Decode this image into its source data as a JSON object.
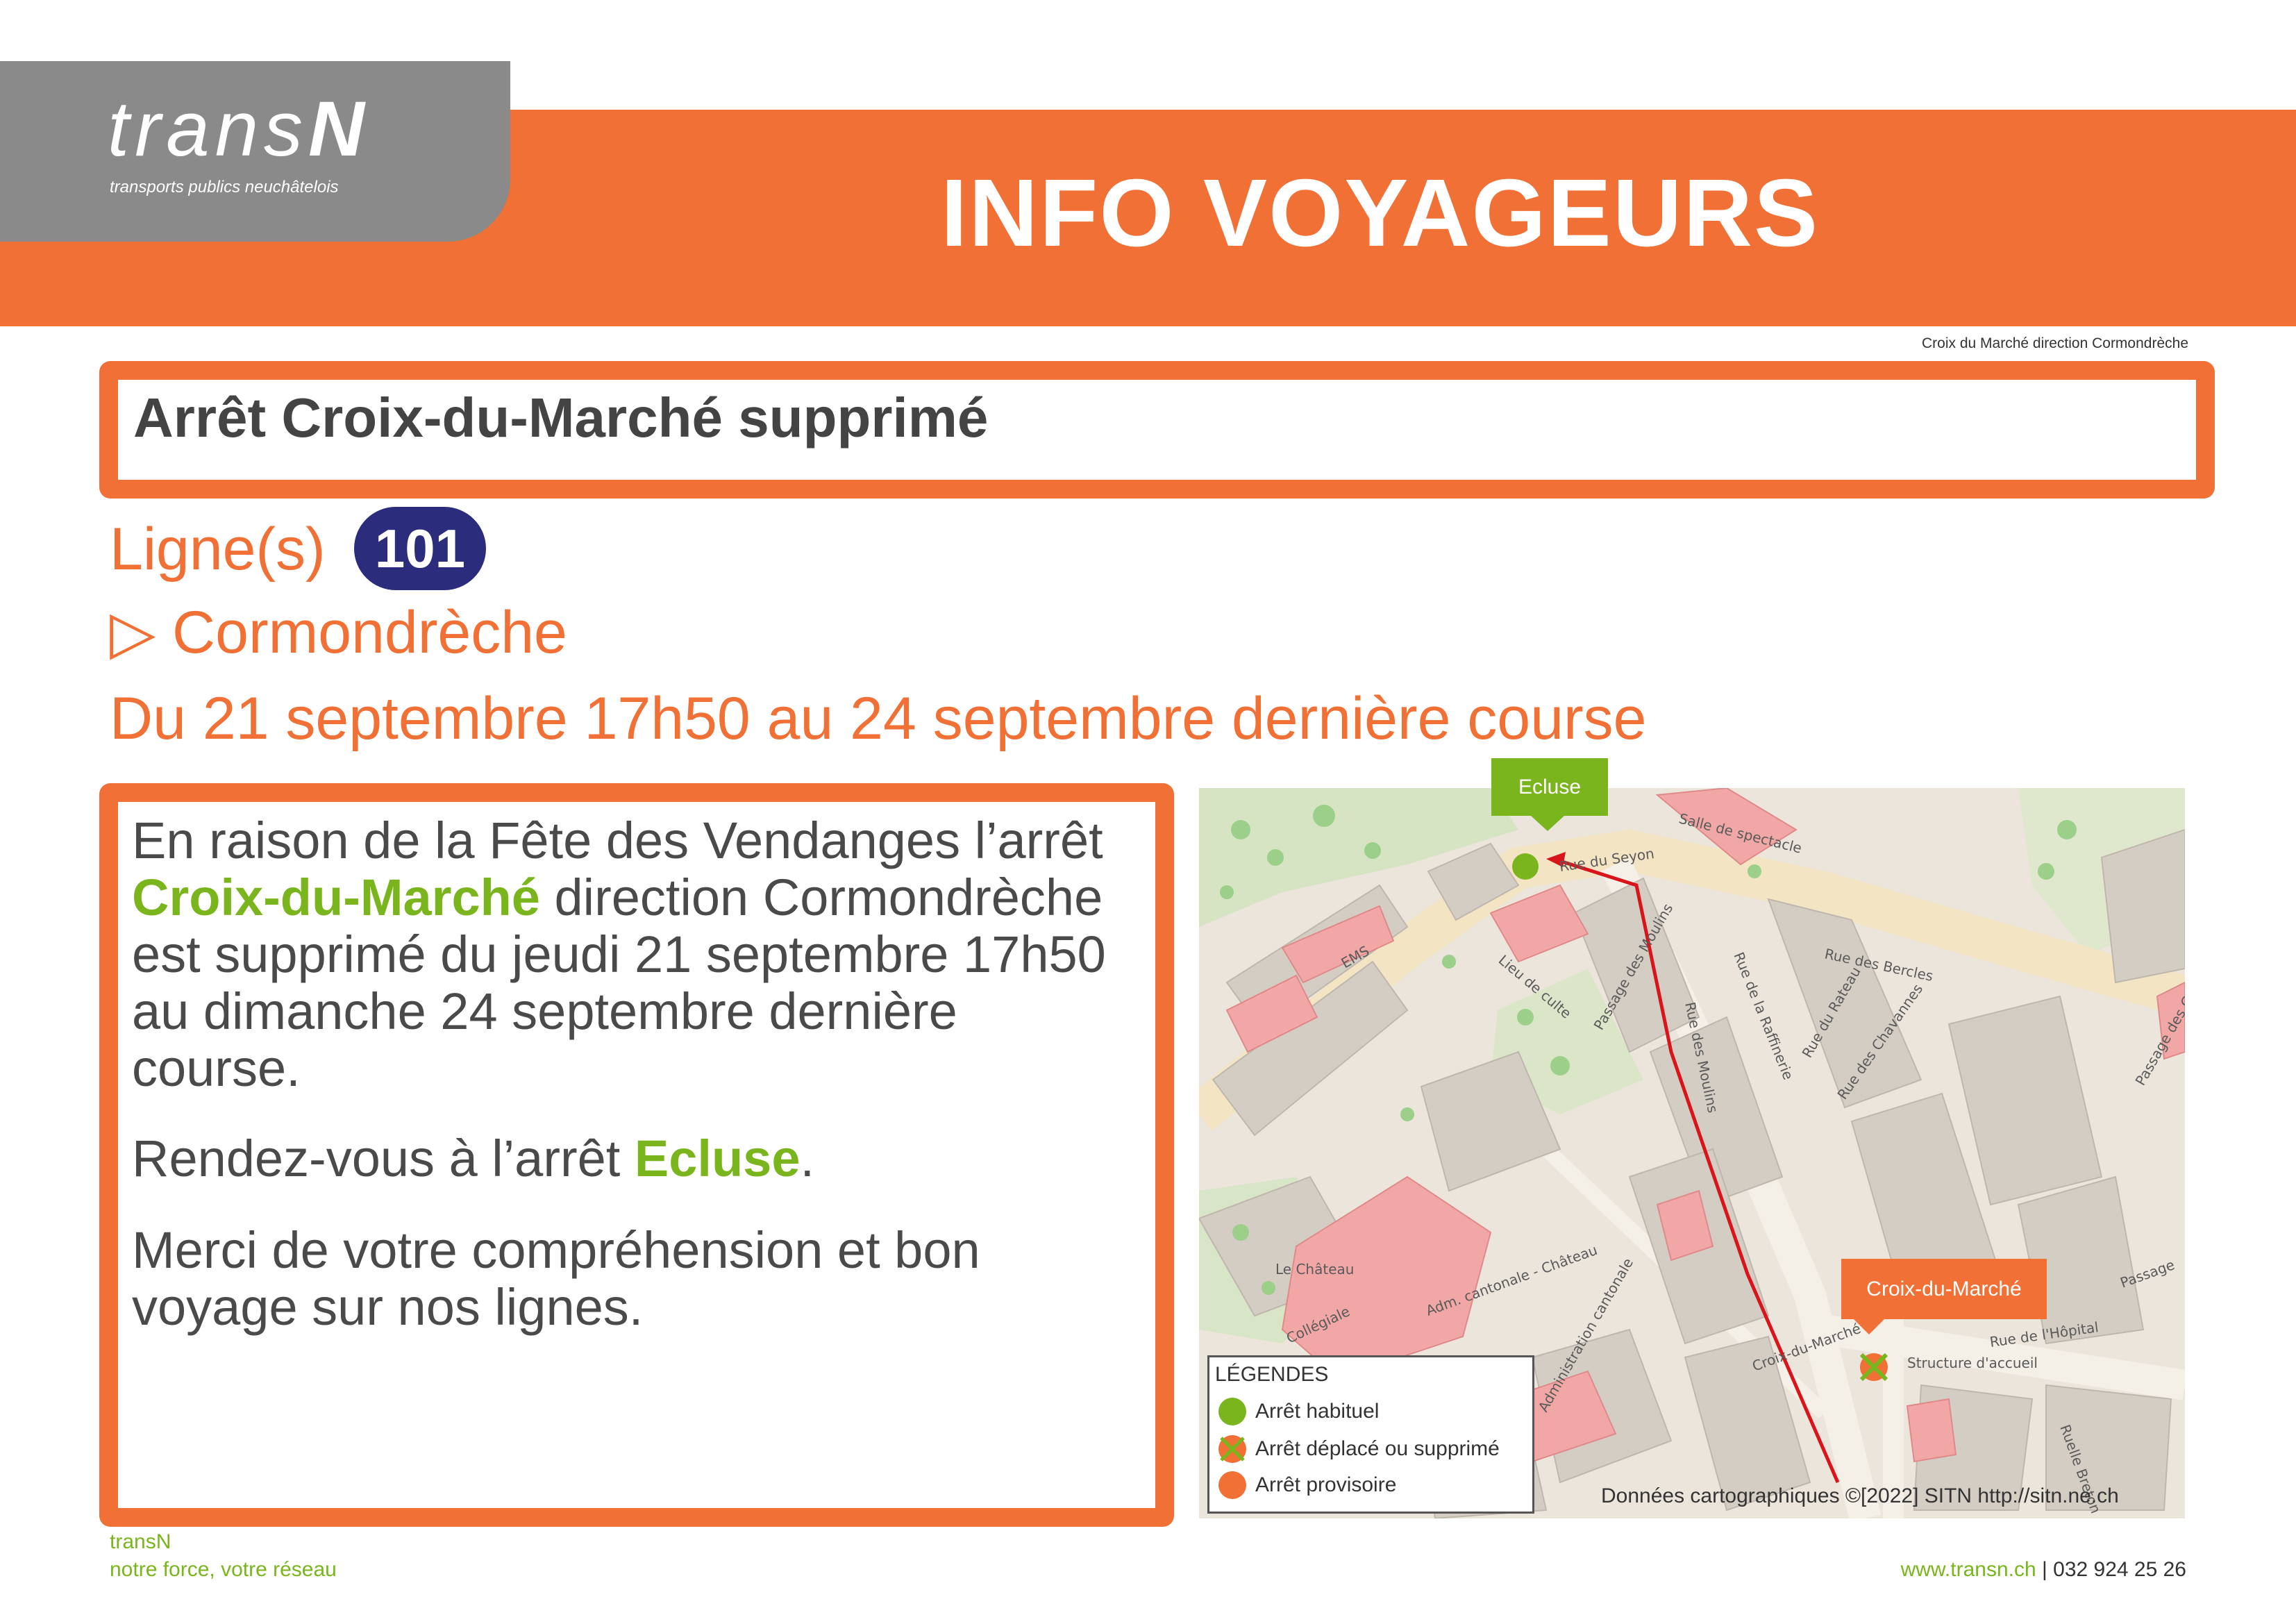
{
  "header": {
    "logo_text_light": "trans",
    "logo_text_bold": "N",
    "logo_subtitle": "transports publics neuchâtelois",
    "title": "INFO VOYAGEURS",
    "reference": "Croix du Marché direction Cormondrèche"
  },
  "notice": {
    "title": "Arrêt Croix-du-Marché supprimé",
    "lines_label": "Ligne(s)",
    "line_number": "101",
    "direction_arrow": "▷",
    "direction": "Cormondrèche",
    "date_range": "Du 21 septembre 17h50 au 24 septembre dernière course"
  },
  "message": {
    "p1_part1": "En raison de la Fête des Vendanges l’arrêt ",
    "p1_stop": "Croix-du-Marché",
    "p1_part2": " direction Cormondrèche est supprimé du jeudi 21 septembre 17h50 au dimanche 24 septembre dernière course.",
    "p2_part1": "Rendez-vous à l’arrêt ",
    "p2_stop": "Ecluse",
    "p2_part2": ".",
    "p3": "Merci de votre compréhension et bon voyage sur nos lignes."
  },
  "map": {
    "stop_usual": "Ecluse",
    "stop_removed": "Croix-du-Marché",
    "street_labels": [
      "Rue du Seyon",
      "Rue des Bercles",
      "Rue de la Raffinerie",
      "Rue du Rateau",
      "Rue des Moulins",
      "Passage des Moulins",
      "Lieu de culte",
      "Salle de spectacle",
      "Structure d'accueil",
      "Rue de l'Hôpital",
      "Croix-du-Marché",
      "Le Château",
      "Collégiale",
      "Adm. cantonale - Château",
      "Administration cantonale",
      "EMS",
      "Passage des Greniers",
      "Rue des Chavannes",
      "Ruelle Breton",
      "Passage"
    ],
    "legend": {
      "title": "LÉGENDES",
      "usual": "Arrêt habituel",
      "moved": "Arrêt déplacé ou supprimé",
      "temporary": "Arrêt provisoire"
    },
    "credit": "Données cartographiques ©[2022] SITN http://sitn.ne.ch"
  },
  "footer": {
    "brand": "transN",
    "slogan": "notre force, votre réseau",
    "website": "www.transn.ch",
    "separator": " | ",
    "phone": "032 924 25 26"
  },
  "colors": {
    "accent_orange": "#f07035",
    "logo_grey": "#8a8a8a",
    "line_badge": "#2b2d7c",
    "highlight_green": "#7ab51d"
  }
}
